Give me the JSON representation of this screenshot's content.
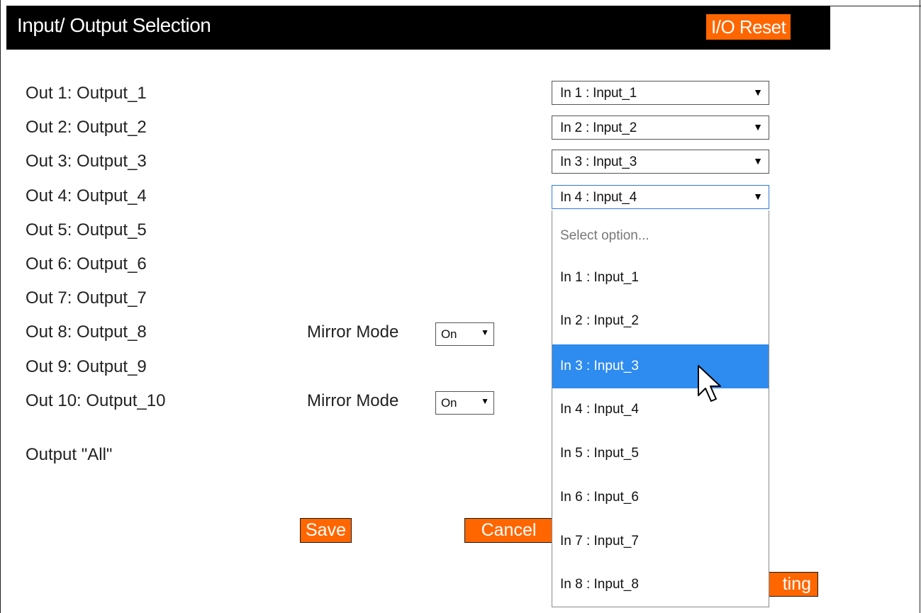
{
  "header": {
    "title": "Input/ Output Selection",
    "reset_label": "I/O Reset"
  },
  "outputs": [
    {
      "label": "Out 1: Output_1",
      "selected": "In 1 : Input_1"
    },
    {
      "label": "Out 2: Output_2",
      "selected": "In 2 : Input_2"
    },
    {
      "label": "Out 3: Output_3",
      "selected": "In 3 : Input_3"
    },
    {
      "label": "Out 4: Output_4",
      "selected": "In 4 : Input_4"
    },
    {
      "label": "Out 5: Output_5"
    },
    {
      "label": "Out 6: Output_6"
    },
    {
      "label": "Out 7: Output_7"
    },
    {
      "label": "Out 8: Output_8",
      "mirror_label": "Mirror Mode",
      "mirror_value": "On"
    },
    {
      "label": "Out 9: Output_9"
    },
    {
      "label": "Out 10: Output_10",
      "mirror_label": "Mirror Mode",
      "mirror_value": "On"
    }
  ],
  "output_all_label": "Output \"All\"",
  "dropdown": {
    "placeholder": "Select option...",
    "options": [
      "In 1 : Input_1",
      "In 2 : Input_2",
      "In 3 : Input_3",
      "In 4 : Input_4",
      "In 5 : Input_5",
      "In 6 : Input_6",
      "In 7 : Input_7",
      "In 8 : Input_8"
    ],
    "highlighted": "In 3 : Input_3"
  },
  "buttons": {
    "save_label": "Save",
    "cancel_label": "Cancel",
    "partial_label": "ting"
  },
  "colors": {
    "accent": "#ff6600",
    "highlight": "#2e8bef",
    "header_bg": "#000000"
  },
  "icons": {
    "dropdown_arrow": "▼",
    "cursor": "arrow-pointer"
  }
}
